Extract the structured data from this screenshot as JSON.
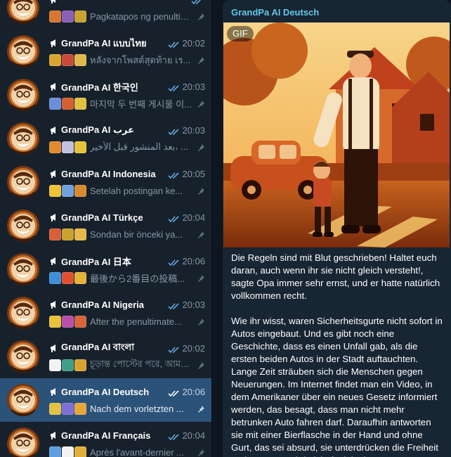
{
  "sidebar": {
    "chats": [
      {
        "title": "",
        "preview": "Pagkatapos ng penultimate...",
        "time": "",
        "active": false,
        "thumbs": [
          "#d9762f",
          "#8a5fb8",
          "#c9a22f"
        ]
      },
      {
        "title": "GrandPa AI แบบไทย",
        "preview": "หลังจากโพสต์สุดท้าย เร...",
        "time": "20:02",
        "active": false,
        "thumbs": [
          "#d9a52f",
          "#c94a3a",
          "#e0b84a"
        ]
      },
      {
        "title": "GrandPa AI 한국인",
        "preview": "마지막 두 번째 게시물 이...",
        "time": "20:03",
        "active": false,
        "thumbs": [
          "#6a8ed8",
          "#d45f2f",
          "#e2c040"
        ]
      },
      {
        "title": "GrandPa AI عرب",
        "preview": "بعد المنشور قبل الأخير، ...",
        "time": "20:03",
        "active": false,
        "thumbs": [
          "#e28a2f",
          "#c4bfe0",
          "#e6c23a"
        ]
      },
      {
        "title": "GrandPa AI Indonesia",
        "preview": "Setelah postingan ke...",
        "time": "20:05",
        "active": false,
        "thumbs": [
          "#f0c23a",
          "#6fa0e0",
          "#d88a2f"
        ]
      },
      {
        "title": "GrandPa AI Türkçe",
        "preview": "Sondan bir önceki ya...",
        "time": "20:04",
        "active": false,
        "thumbs": [
          "#d85f3a",
          "#c9a22f",
          "#e8b84a"
        ]
      },
      {
        "title": "GrandPa AI 日本",
        "preview": "最後から2番目の投稿...",
        "time": "20:06",
        "active": false,
        "thumbs": [
          "#3f8fd8",
          "#e0502f",
          "#e6b23a"
        ]
      },
      {
        "title": "GrandPa AI Nigeria",
        "preview": "After the penultimate...",
        "time": "20:03",
        "active": false,
        "thumbs": [
          "#e8c23a",
          "#b84fa8",
          "#d8643a"
        ]
      },
      {
        "title": "GrandPa AI বাংলা",
        "preview": "চূড়ান্ত পোস্টের পরে, আমরা...",
        "time": "20:02",
        "active": false,
        "thumbs": [
          "#f2f2f2",
          "#3f9f8a",
          "#d8a42f"
        ]
      },
      {
        "title": "GrandPa AI Deutsch",
        "preview": "Nach dem vorletzten ...",
        "time": "20:06",
        "active": true,
        "thumbs": [
          "#e6c040",
          "#7f6fd8",
          "#e8a53a"
        ]
      },
      {
        "title": "GrandPa AI Français",
        "preview": "Après l'avant-dernier ...",
        "time": "20:04",
        "active": false,
        "thumbs": [
          "#5f9fe0",
          "#f4f4f4",
          "#e2b03a"
        ]
      }
    ]
  },
  "main": {
    "channel_name": "GrandPa AI Deutsch",
    "gif_label": "GIF",
    "paragraphs": [
      "Die Regeln sind mit Blut geschrieben! Haltet euch daran, auch wenn ihr sie nicht gleich versteht!, sagte Opa immer sehr ernst, und er hatte natürlich vollkommen recht.",
      "Wie ihr wisst, waren Sicherheitsgurte nicht sofort in Autos eingebaut. Und es gibt noch eine Geschichte, dass es einen Unfall gab, als die ersten beiden Autos in der Stadt auftauchten. Lange Zeit sträuben sich die Menschen gegen Neuerungen. Im Internet findet man ein Video, in dem Amerikaner über ein neues Gesetz informiert werden, das besagt, dass man nicht mehr betrunken Auto fahren darf. Daraufhin antworten sie mit einer Bierflasche in der Hand und ohne Gurt, das sei absurd, sie unterdrücken die Freiheit und so etwas wird nicht funktionieren."
    ]
  },
  "colors": {
    "sidebar_bg": "#17212b",
    "active_bg": "#2b5278",
    "accent": "#64c7e6",
    "check": "#64a8e6",
    "muted_text": "#8596a8"
  },
  "icons": {
    "channel": "megaphone-icon",
    "read": "double-check-icon",
    "pinned": "pin-icon"
  }
}
